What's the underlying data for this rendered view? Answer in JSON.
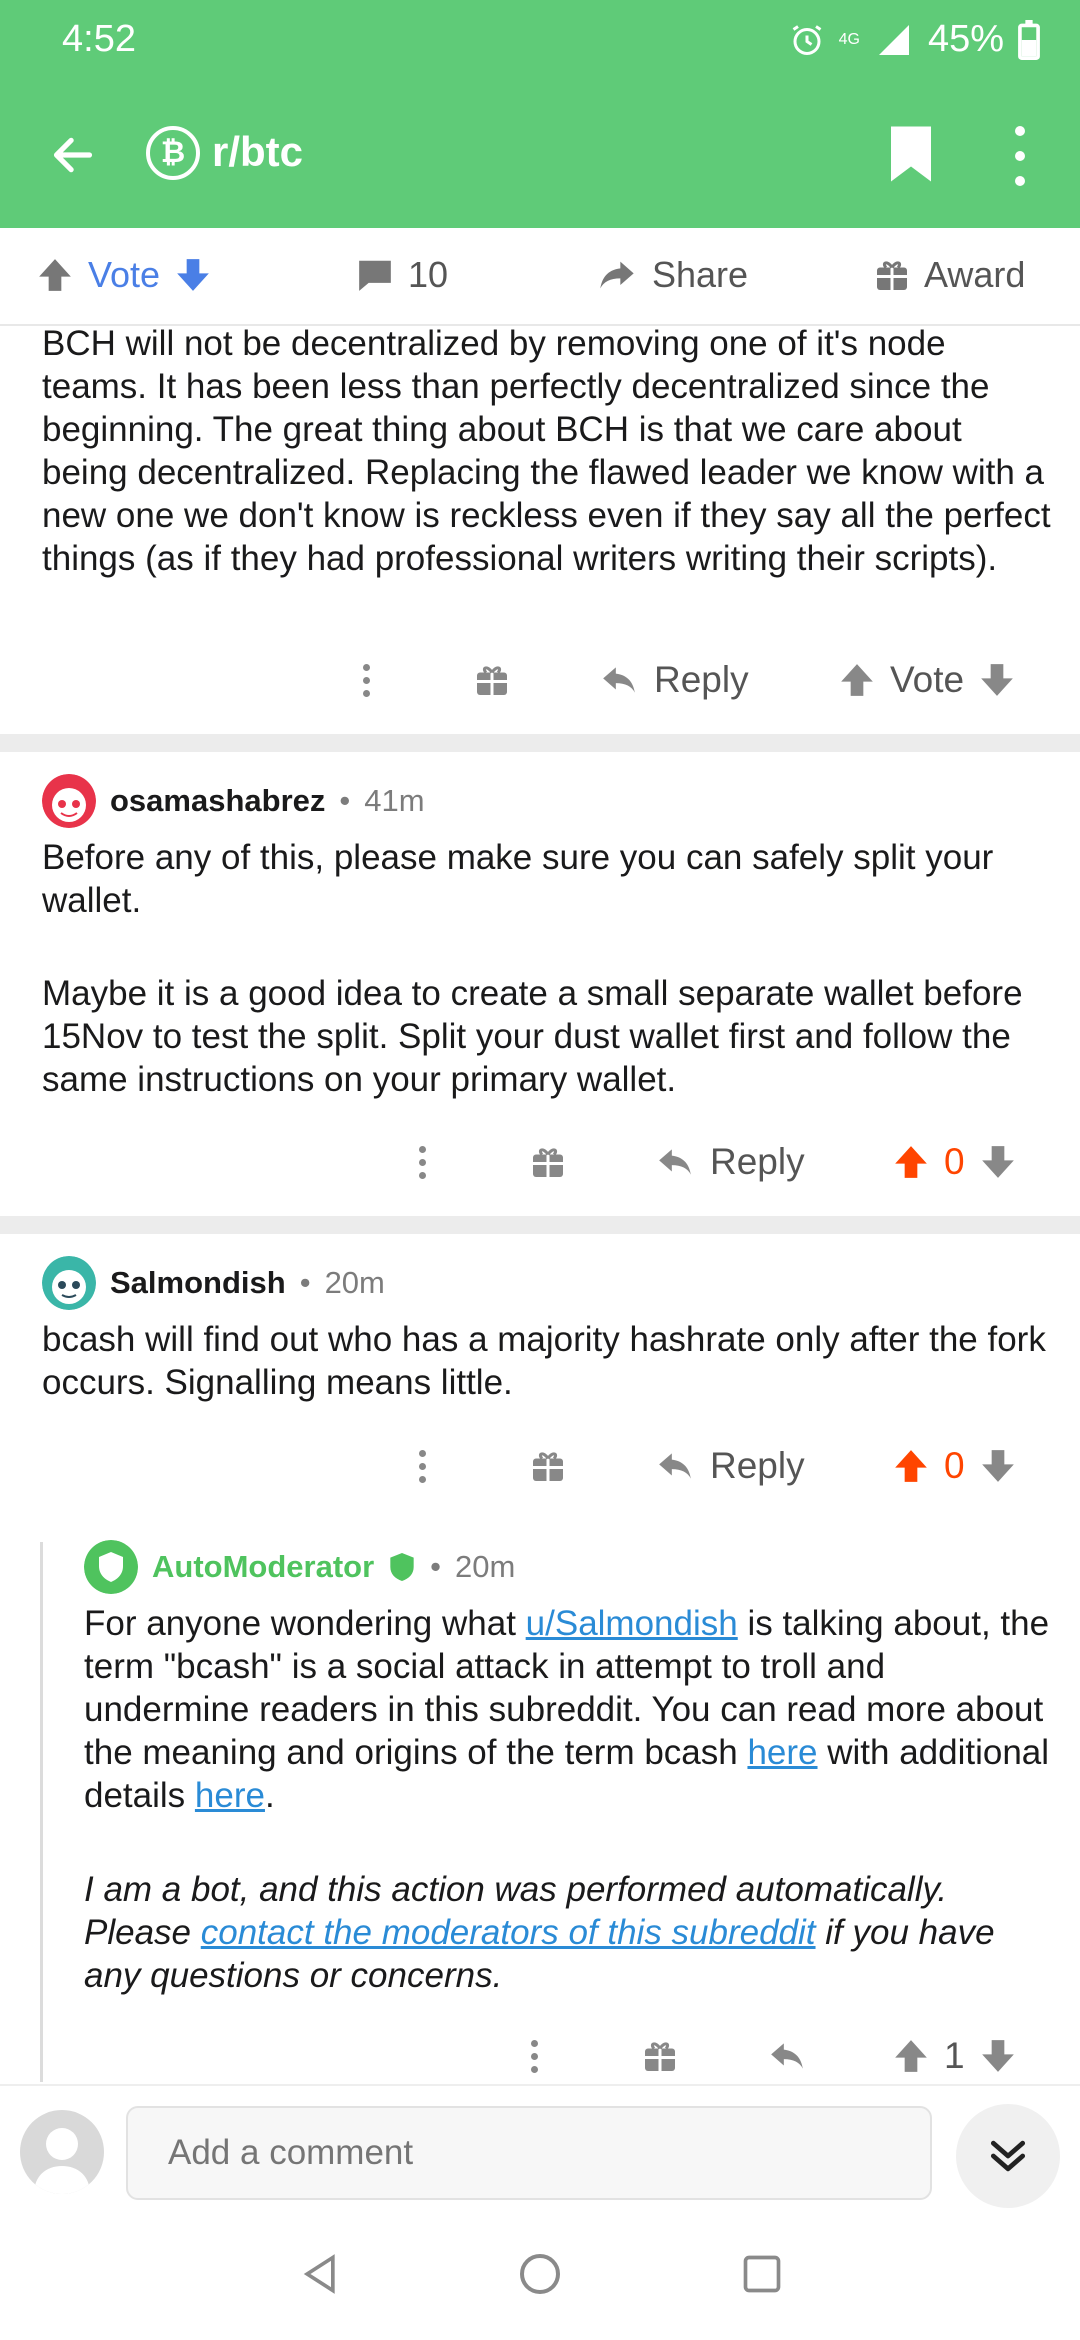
{
  "status": {
    "time": "4:52",
    "network": "4G",
    "battery": "45%"
  },
  "toolbar": {
    "subreddit": "r/btc"
  },
  "post_actions": {
    "vote_label": "Vote",
    "comments_count": "10",
    "share_label": "Share",
    "award_label": "Award"
  },
  "comment0": {
    "body": "BCH will not be decentralized by removing one of it's node teams. It has been less than perfectly decentralized since the beginning. The great thing about BCH is that we care about being decentralized. Replacing the flawed leader we know with a new one we don't know is reckless even if they say all the perfect things (as if they had professional writers writing their scripts).",
    "reply_label": "Reply",
    "vote_label": "Vote"
  },
  "comment1": {
    "author": "osamashabrez",
    "age": "41m",
    "para1": "Before any of this, please make sure you can safely split your wallet.",
    "para2": "Maybe it is a good idea to create a small separate wallet before 15Nov to test the split. Split your dust wallet first and follow the same instructions on your primary wallet.",
    "reply_label": "Reply",
    "score": "0"
  },
  "comment2": {
    "author": "Salmondish",
    "age": "20m",
    "body": "bcash will find out who has a majority hashrate only after the fork occurs. Signalling means little.",
    "reply_label": "Reply",
    "score": "0"
  },
  "comment3": {
    "author": "AutoModerator",
    "age": "20m",
    "t1": "For anyone wondering what ",
    "user_link": "u/Salmondish",
    "t2": " is talking about, the term \"bcash\" is a social attack in attempt to troll and undermine readers in this subreddit. You can read more about the meaning and origins of the term bcash ",
    "here1": "here",
    "t3": " with additional details ",
    "here2": "here",
    "t4": ".",
    "bot1": "I am a bot, and this action was performed automatically. Please ",
    "contact_link": "contact the moderators of this subreddit",
    "bot2": " if you have any questions or concerns.",
    "score": "1"
  },
  "composer": {
    "placeholder": "Add a comment"
  },
  "colors": {
    "header": "#5fcb78",
    "upvote_active": "#ff4500",
    "link": "#2a8bd6"
  }
}
